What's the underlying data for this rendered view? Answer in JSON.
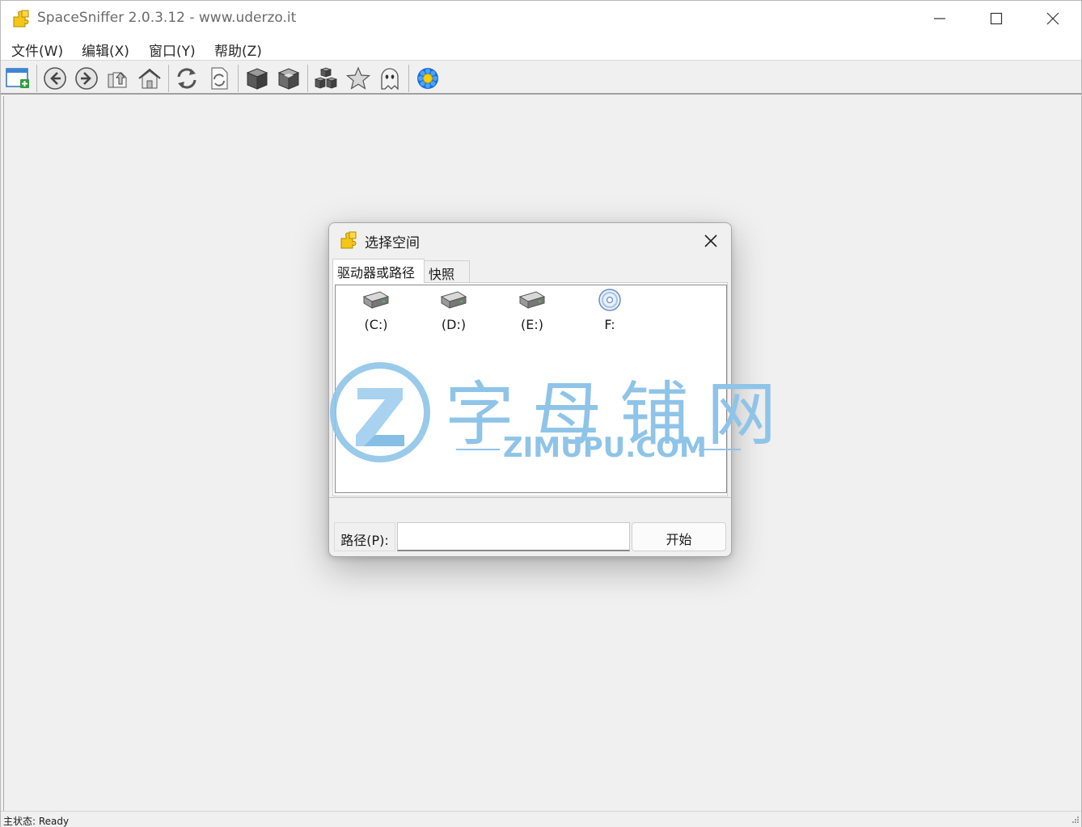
{
  "window": {
    "title": "SpaceSniffer 2.0.3.12 - www.uderzo.it"
  },
  "menu": {
    "items": [
      {
        "label": "文件(W)"
      },
      {
        "label": "编辑(X)"
      },
      {
        "label": "窗口(Y)"
      },
      {
        "label": "帮助(Z)"
      }
    ]
  },
  "toolbar": {
    "buttons": [
      {
        "icon": "new-window-icon"
      },
      {
        "icon": "back-arrow-icon"
      },
      {
        "icon": "forward-arrow-icon"
      },
      {
        "icon": "up-folder-icon"
      },
      {
        "icon": "home-icon"
      },
      {
        "icon": "refresh-icon"
      },
      {
        "icon": "refresh-document-icon"
      },
      {
        "icon": "zoom-in-cube-icon"
      },
      {
        "icon": "zoom-out-cube-icon"
      },
      {
        "icon": "cubes-icon"
      },
      {
        "icon": "star-icon"
      },
      {
        "icon": "ghost-icon"
      },
      {
        "icon": "settings-flower-icon"
      }
    ]
  },
  "dialog": {
    "title": "选择空间",
    "tabs": [
      {
        "label": "驱动器或路径",
        "active": true
      },
      {
        "label": "快照",
        "active": false
      }
    ],
    "drives": [
      {
        "label": "(C:)",
        "icon": "hard-drive-icon"
      },
      {
        "label": "(D:)",
        "icon": "hard-drive-icon"
      },
      {
        "label": "(E:)",
        "icon": "hard-drive-icon"
      },
      {
        "label": "F:",
        "icon": "cd-drive-icon"
      }
    ],
    "path_label": "路径(P):",
    "path_value": "",
    "start_label": "开始"
  },
  "watermark": {
    "chinese": "字母铺网",
    "english": "ZIMUPU.COM",
    "color": "#8fc4e8"
  },
  "status": {
    "text": "主状态: Ready"
  }
}
